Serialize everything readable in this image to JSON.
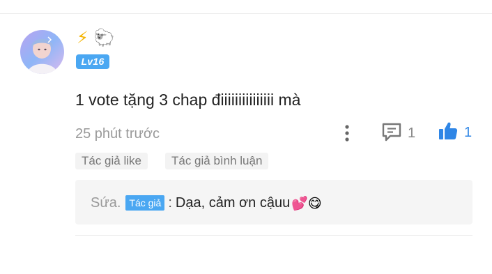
{
  "user": {
    "avatar_alt": "user avatar",
    "badges": [
      "⚡",
      "🐑"
    ],
    "level": "Lv16"
  },
  "comment": {
    "text": "1 vote tặng 3 chap điiiiiiiiiiiiiii mà",
    "timestamp": "25 phút trước",
    "reply_count": "1",
    "like_count": "1",
    "tags": [
      "Tác giả like",
      "Tác giả bình luận"
    ]
  },
  "reply": {
    "author": "Sứa.",
    "author_badge": "Tác giả",
    "separator": ":",
    "text": "Dạa, cảm ơn cậuu",
    "emojis": "💕😋"
  },
  "colors": {
    "accent": "#4aa7f2",
    "like": "#2f86e6",
    "muted": "#9a9a9a"
  }
}
